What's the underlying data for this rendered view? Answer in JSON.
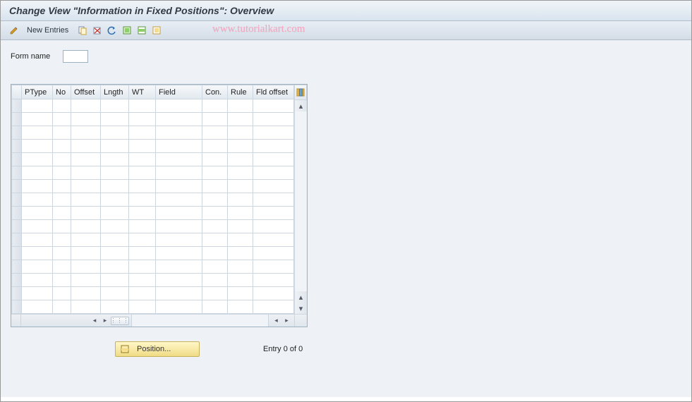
{
  "title": "Change View \"Information in Fixed Positions\": Overview",
  "toolbar": {
    "new_entries_label": "New Entries"
  },
  "watermark": "www.tutorialkart.com",
  "form": {
    "name_label": "Form name",
    "name_value": ""
  },
  "table": {
    "columns": [
      {
        "label": "PType",
        "width": 44
      },
      {
        "label": "No",
        "width": 26
      },
      {
        "label": "Offset",
        "width": 42
      },
      {
        "label": "Lngth",
        "width": 40
      },
      {
        "label": "WT",
        "width": 38
      },
      {
        "label": "Field",
        "width": 66
      },
      {
        "label": "Con.",
        "width": 36
      },
      {
        "label": "Rule",
        "width": 36
      },
      {
        "label": "Fld offset",
        "width": 58
      }
    ],
    "row_count": 16
  },
  "footer": {
    "position_label": "Position...",
    "entry_text": "Entry 0 of 0"
  }
}
